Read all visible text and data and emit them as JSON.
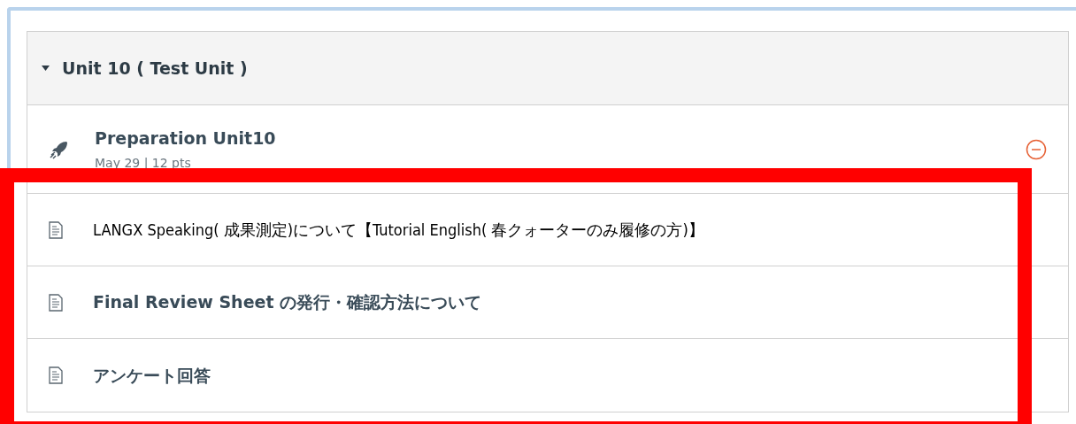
{
  "module": {
    "title": "Unit 10 ( Test Unit )",
    "expanded": true,
    "items": [
      {
        "kind": "quiz",
        "title": "Preparation Unit10",
        "meta": "May 29 | 12 pts",
        "missing": true
      },
      {
        "kind": "page",
        "title": "LANGX Speaking( 成果測定)について【Tutorial English( 春クォーターのみ履修の方)】",
        "missing": false
      },
      {
        "kind": "page",
        "title": "Final Review Sheet の発行・確認方法について",
        "missing": false
      },
      {
        "kind": "page",
        "title": "アンケート回答",
        "missing": false
      }
    ]
  }
}
